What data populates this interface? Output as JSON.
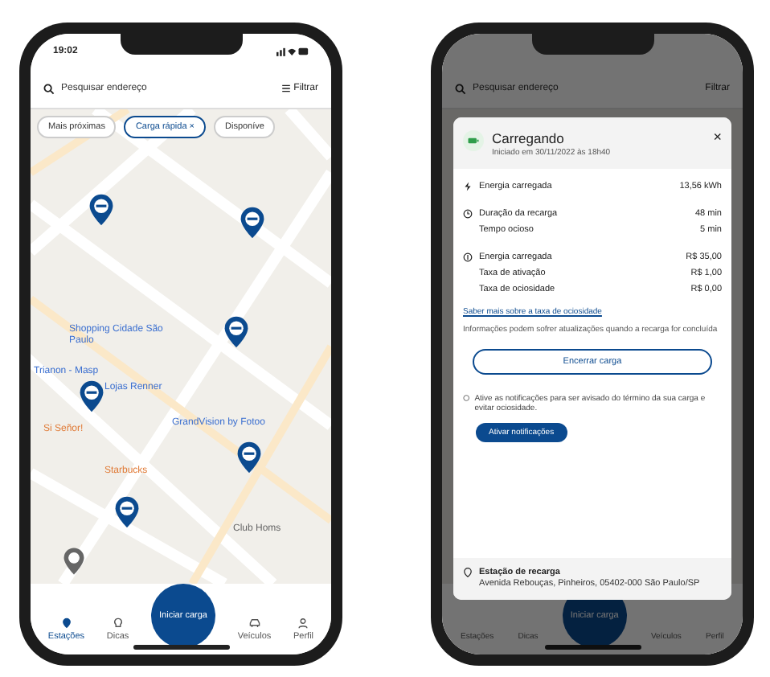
{
  "map_screen": {
    "status_time": "19:02",
    "search": {
      "placeholder": "Pesquisar endereço"
    },
    "filter_label": "Filtrar",
    "chips": [
      {
        "label": "Mais próximas",
        "selected": false
      },
      {
        "label": "Carga rápida",
        "selected": true,
        "remove": "×"
      },
      {
        "label": "Disponíve",
        "selected": false
      }
    ],
    "map_labels": [
      {
        "text": "Shopping Cidade São Paulo",
        "kind": "shop"
      },
      {
        "text": "Trianon - Masp",
        "kind": "transit"
      },
      {
        "text": "Lojas Renner",
        "kind": "shop"
      },
      {
        "text": "Si Señor!",
        "kind": "food"
      },
      {
        "text": "GrandVision by Fotoo",
        "kind": "shop"
      },
      {
        "text": "Starbucks",
        "kind": "food"
      },
      {
        "text": "Club Homs",
        "kind": "place"
      }
    ],
    "nav": [
      {
        "label": "Estações",
        "kind": "pin",
        "selected": true
      },
      {
        "label": "Dicas",
        "kind": "bulb",
        "selected": false
      },
      {
        "label": "Veículos",
        "kind": "car",
        "selected": false
      },
      {
        "label": "Perfil",
        "kind": "person",
        "selected": false
      }
    ],
    "center_button": "Iniciar carga"
  },
  "charging_screen": {
    "search": {
      "placeholder": "Pesquisar endereço"
    },
    "filter_label": "Filtrar",
    "sheet": {
      "title": "Carregando",
      "subtitle": "Iniciado em 30/11/2022 às 18h40",
      "close": "×",
      "groups": [
        {
          "kind": "bolt",
          "rows": [
            {
              "label": "Energia carregada",
              "value": "13,56 kWh"
            }
          ]
        },
        {
          "kind": "clock",
          "rows": [
            {
              "label": "Duração da recarga",
              "value": "48 min"
            },
            {
              "label": "Tempo ocioso",
              "value": "5 min"
            }
          ]
        },
        {
          "kind": "money",
          "rows": [
            {
              "label": "Energia carregada",
              "value": "R$ 35,00"
            },
            {
              "label": "Taxa de ativação",
              "value": "R$ 1,00"
            },
            {
              "label": "Taxa de ociosidade",
              "value": "R$ 0,00"
            }
          ]
        }
      ],
      "link": "Saber mais sobre a taxa de ociosidade",
      "note": "Informações podem sofrer atualizações quando a recarga for concluída",
      "end_button": "Encerrar carga",
      "notice": "Ative as notificações para ser avisado do término da sua carga e evitar ociosidade.",
      "notify_button": "Ativar notificações",
      "station_title": "Estação de recarga",
      "station_address": "Avenida Rebouças, Pinheiros, 05402-000 São Paulo/SP"
    },
    "nav": [
      {
        "label": "Estações"
      },
      {
        "label": "Dicas"
      },
      {
        "label": "Veículos"
      },
      {
        "label": "Perfil"
      }
    ],
    "center_button": "Iniciar carga"
  }
}
